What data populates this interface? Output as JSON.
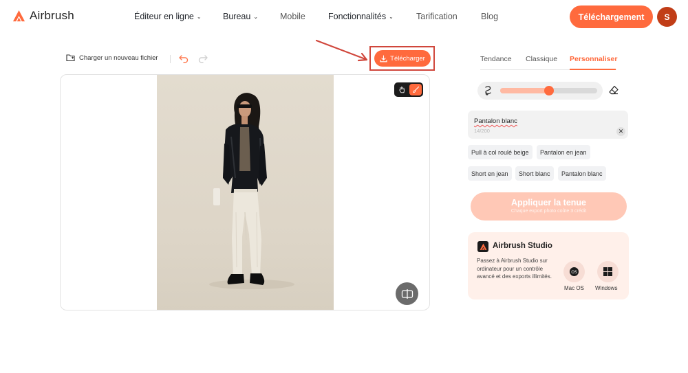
{
  "header": {
    "brand": "Airbrush",
    "nav": [
      {
        "label": "Éditeur en ligne",
        "dropdown": true
      },
      {
        "label": "Bureau",
        "dropdown": true
      },
      {
        "label": "Mobile",
        "dropdown": false
      },
      {
        "label": "Fonctionnalités",
        "dropdown": true
      },
      {
        "label": "Tarification",
        "dropdown": false
      },
      {
        "label": "Blog",
        "dropdown": false
      }
    ],
    "download_label": "Téléchargement",
    "avatar_initial": "S"
  },
  "toolbar": {
    "upload_label": "Charger un nouveau fichier",
    "download_label": "Télécharger"
  },
  "right_panel": {
    "tabs": [
      {
        "label": "Tendance",
        "active": false
      },
      {
        "label": "Classique",
        "active": false
      },
      {
        "label": "Personnaliser",
        "active": true
      }
    ],
    "brush_size": 0.5,
    "prompt": {
      "value": "Pantalon blanc",
      "count": "14/200"
    },
    "suggestions": [
      "Pull à col roulé beige",
      "Pantalon en jean",
      "Short en jean",
      "Short blanc",
      "Pantalon blanc"
    ],
    "apply": {
      "label": "Appliquer la tenue",
      "sublabel": "Chaque export photo coûte 3 crédit"
    },
    "studio": {
      "title": "Airbrush Studio",
      "description": "Passez à Airbrush Studio sur ordinateur pour un contrôle avancé et des exports illimités.",
      "mac_label": "Mac OS",
      "windows_label": "Windows"
    }
  },
  "colors": {
    "accent": "#ff6a3d",
    "accent_light": "#ffc8b6",
    "highlight_box": "#d0463b"
  }
}
